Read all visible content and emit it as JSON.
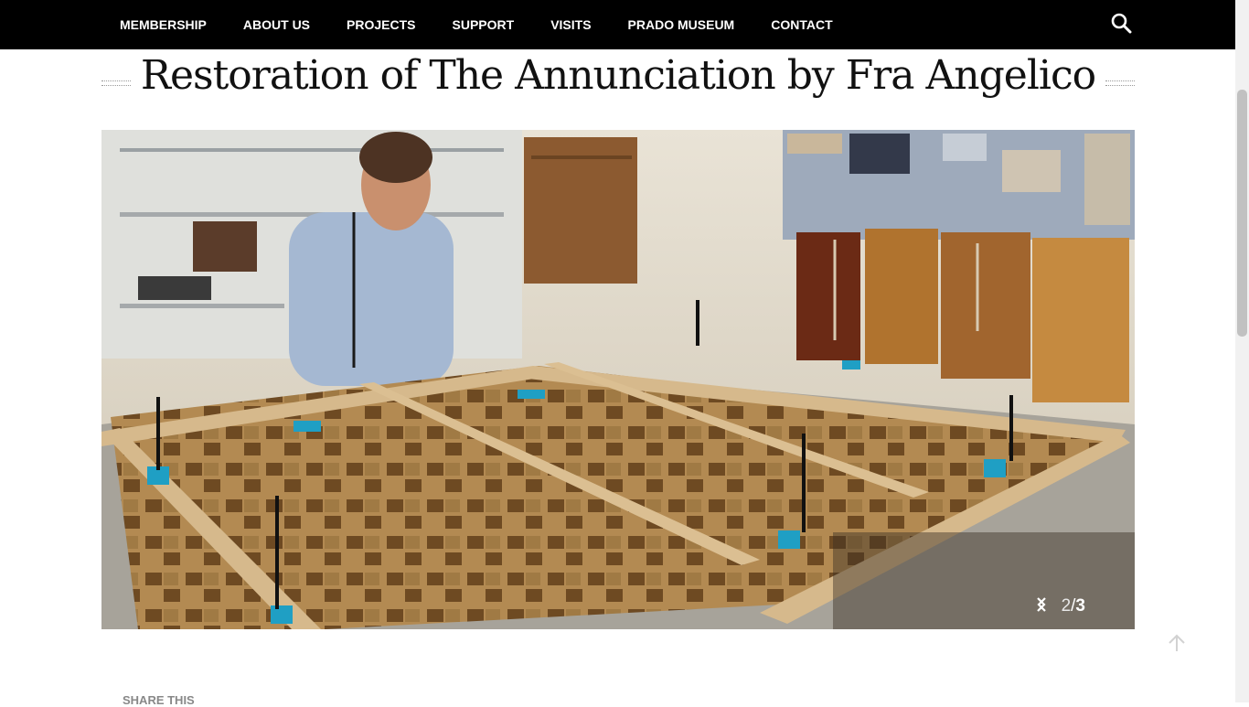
{
  "nav": {
    "items": [
      "MEMBERSHIP",
      "ABOUT US",
      "PROJECTS",
      "SUPPORT",
      "VISITS",
      "PRADO MUSEUM",
      "CONTACT"
    ]
  },
  "page": {
    "title": "Restoration of The Annunciation by Fra Angelico"
  },
  "slider": {
    "current": "2",
    "separator": "/",
    "total": "3"
  },
  "share": {
    "label": "SHARE THIS"
  },
  "colors": {
    "topbar": "#000000",
    "nav_text": "#ffffff"
  }
}
